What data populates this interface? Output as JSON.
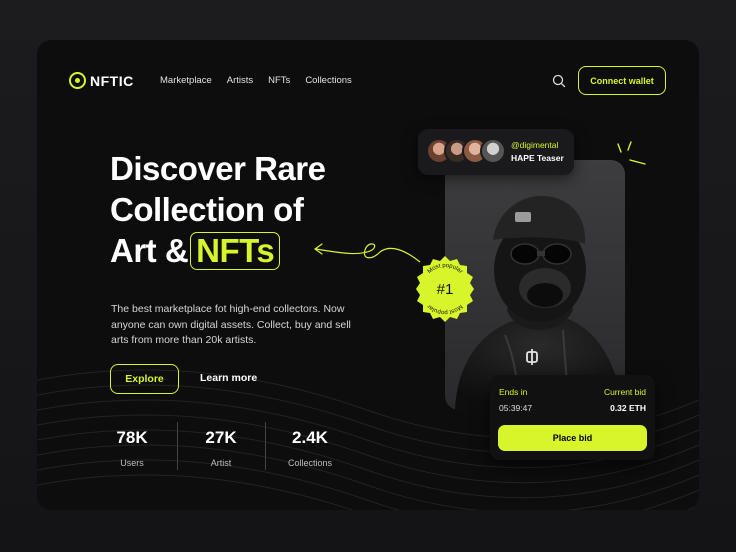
{
  "nav": {
    "logo": "NFTIC",
    "links": [
      "Marketplace",
      "Artists",
      "NFTs",
      "Collections"
    ],
    "connect_label": "Connect wallet"
  },
  "hero": {
    "line1": "Discover Rare",
    "line2": "Collection of",
    "line3": "Art &",
    "highlight": "NFTs",
    "description": "The best marketplace fot high-end collectors. Now anyone can own digital assets. Collect, buy and sell arts from more than 20k artists.",
    "explore_label": "Explore",
    "learn_label": "Learn more"
  },
  "stats": [
    {
      "value": "78K",
      "label": "Users"
    },
    {
      "value": "27K",
      "label": "Artist"
    },
    {
      "value": "2.4K",
      "label": "Collections"
    }
  ],
  "owners": {
    "handle": "@digimental",
    "title": "HAPE Teaser"
  },
  "badge": {
    "rank": "#1",
    "ring_text": "Most popular"
  },
  "bid": {
    "ends_label": "Ends in",
    "ends_value": "05:39:47",
    "current_label": "Current bid",
    "current_value": "0.32 ETH",
    "button_label": "Place bid"
  },
  "colors": {
    "accent": "#d7f52a",
    "card": "#0d0d0e",
    "page": "#18181a"
  }
}
